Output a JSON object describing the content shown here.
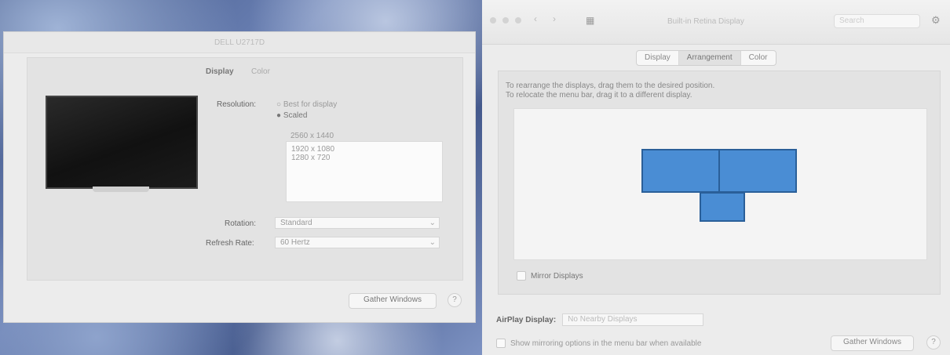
{
  "left_window": {
    "title": "DELL U2717D",
    "tab_display": "Display",
    "tab_color": "Color",
    "resolution_label": "Resolution:",
    "resolution_default": "Best for display",
    "resolution_scaled": "Scaled",
    "resolutions": [
      "2560 x 1440",
      "1920 x 1080",
      "1280 x 720"
    ],
    "rotation_label": "Rotation:",
    "rotation_value": "Standard",
    "refresh_label": "Refresh Rate:",
    "refresh_value": "60 Hertz",
    "gather_button": "Gather Windows",
    "help": "?"
  },
  "right_window": {
    "title": "Built-in Retina Display",
    "search_placeholder": "Search",
    "tabs": [
      "Display",
      "Arrangement",
      "Color"
    ],
    "instruction_1": "To rearrange the displays, drag them to the desired position.",
    "instruction_2": "To relocate the menu bar, drag it to a different display.",
    "mirror_label": "Mirror Displays",
    "airplay_label": "AirPlay Display:",
    "airplay_value": "No Nearby Displays",
    "menubar_option": "Show mirroring options in the menu bar when available",
    "gather_button": "Gather Windows",
    "help": "?"
  },
  "icons": {
    "back": "chevron-left-icon",
    "forward": "chevron-right-icon",
    "grid": "grid-icon",
    "settings": "gear-icon"
  }
}
